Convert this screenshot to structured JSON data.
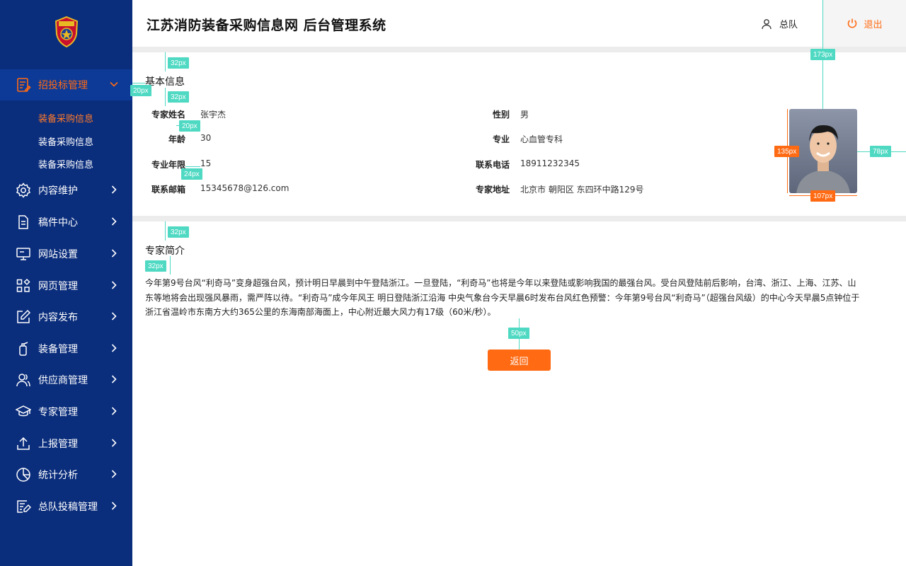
{
  "header": {
    "title": "江苏消防装备采购信息网  后台管理系统",
    "user": "总队",
    "logout": "退出"
  },
  "sidebar": {
    "items": [
      {
        "label": "招投标管理",
        "icon": "bid-icon",
        "active": true
      },
      {
        "label": "内容维护",
        "icon": "gear-icon"
      },
      {
        "label": "稿件中心",
        "icon": "document-icon"
      },
      {
        "label": "网站设置",
        "icon": "monitor-icon"
      },
      {
        "label": "网页管理",
        "icon": "grid-icon"
      },
      {
        "label": "内容发布",
        "icon": "edit-icon"
      },
      {
        "label": "装备管理",
        "icon": "extinguisher-icon"
      },
      {
        "label": "供应商管理",
        "icon": "users-icon"
      },
      {
        "label": "专家管理",
        "icon": "graduation-cap-icon"
      },
      {
        "label": "上报管理",
        "icon": "upload-icon"
      },
      {
        "label": "统计分析",
        "icon": "pie-chart-icon"
      },
      {
        "label": "总队投稿管理",
        "icon": "list-edit-icon"
      }
    ],
    "subitems": [
      "装备采购信息",
      "装备采购信息",
      "装备采购信息"
    ]
  },
  "basic": {
    "title": "基本信息",
    "fields": {
      "name_label": "专家姓名",
      "name": "张宇杰",
      "gender_label": "性别",
      "gender": "男",
      "age_label": "年龄",
      "age": "30",
      "major_label": "专业",
      "major": "心血管专科",
      "years_label": "专业年限",
      "years": "15",
      "phone_label": "联系电话",
      "phone": "18911232345",
      "email_label": "联系邮箱",
      "email": "15345678@126.com",
      "address_label": "专家地址",
      "address": "北京市 朝阳区 东四环中路129号"
    }
  },
  "intro": {
    "title": "专家简介",
    "text": "今年第9号台风“利奇马”变身超强台风，预计明日早晨到中午登陆浙江。一旦登陆，“利奇马”也将是今年以来登陆或影响我国的最强台风。受台风登陆前后影响，台湾、浙江、上海、江苏、山东等地将会出现强风暴雨，需严阵以待。“利奇马”成今年风王  明日登陆浙江沿海  中央气象台今天早晨6时发布台风红色预警：今年第9号台风“利奇马”（超强台风级）的中心今天早晨5点钟位于浙江省温岭市东南方大约365公里的东海南部海面上，中心附近最大风力有17级（60米/秒）。"
  },
  "back_button": "返回",
  "annotations": {
    "a1": "32px",
    "a2": "20px",
    "a3": "32px",
    "a4": "20px",
    "a5": "24px",
    "a6": "32px",
    "a7": "32px",
    "a8": "50px",
    "a9": "173px",
    "a10": "135px",
    "a11": "78px",
    "a12": "107px"
  },
  "colors": {
    "sidebar": "#0a2d7c",
    "accent": "#ff6a13",
    "annotation": "#4fd9c3"
  }
}
